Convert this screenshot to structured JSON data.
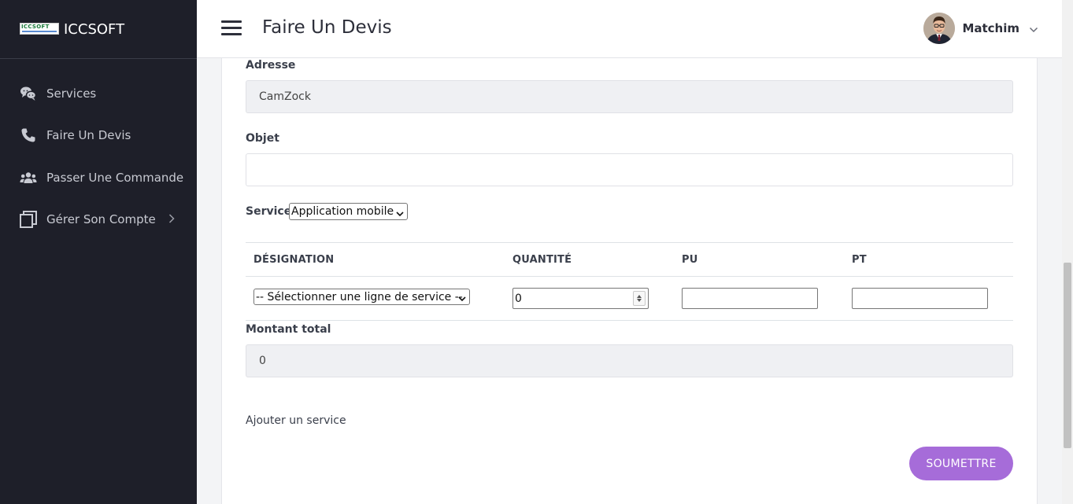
{
  "brand": {
    "logo_text": "ICCSOFT",
    "name": "ICCSOFT"
  },
  "sidebar": {
    "items": [
      {
        "label": "Services",
        "icon": "chat-bubbles-icon"
      },
      {
        "label": "Faire Un Devis",
        "icon": "phone-icon"
      },
      {
        "label": "Passer Une Commande",
        "icon": "users-icon"
      },
      {
        "label": "Gérer Son Compte",
        "icon": "copy-icon",
        "has_submenu": true
      }
    ]
  },
  "header": {
    "title": "Faire Un Devis",
    "user_name": "Matchim"
  },
  "form": {
    "adresse_label": "Adresse",
    "adresse_value": "CamZock",
    "objet_label": "Objet",
    "objet_value": "",
    "service_label": "Service",
    "service_selected": "Application mobile",
    "table": {
      "headers": [
        "DÉSIGNATION",
        "QUANTITÉ",
        "PU",
        "PT"
      ],
      "row": {
        "designation_selected": "-- Sélectionner une ligne de service --",
        "quantite": "0",
        "pu": "",
        "pt": ""
      }
    },
    "montant_label": "Montant total",
    "montant_value": "0",
    "add_service_label": "Ajouter un service",
    "submit_label": "SOUMETTRE"
  },
  "colors": {
    "sidebar_bg": "#1e1f29",
    "accent": "#a66cd9",
    "readonly_bg": "#eff0f3"
  }
}
